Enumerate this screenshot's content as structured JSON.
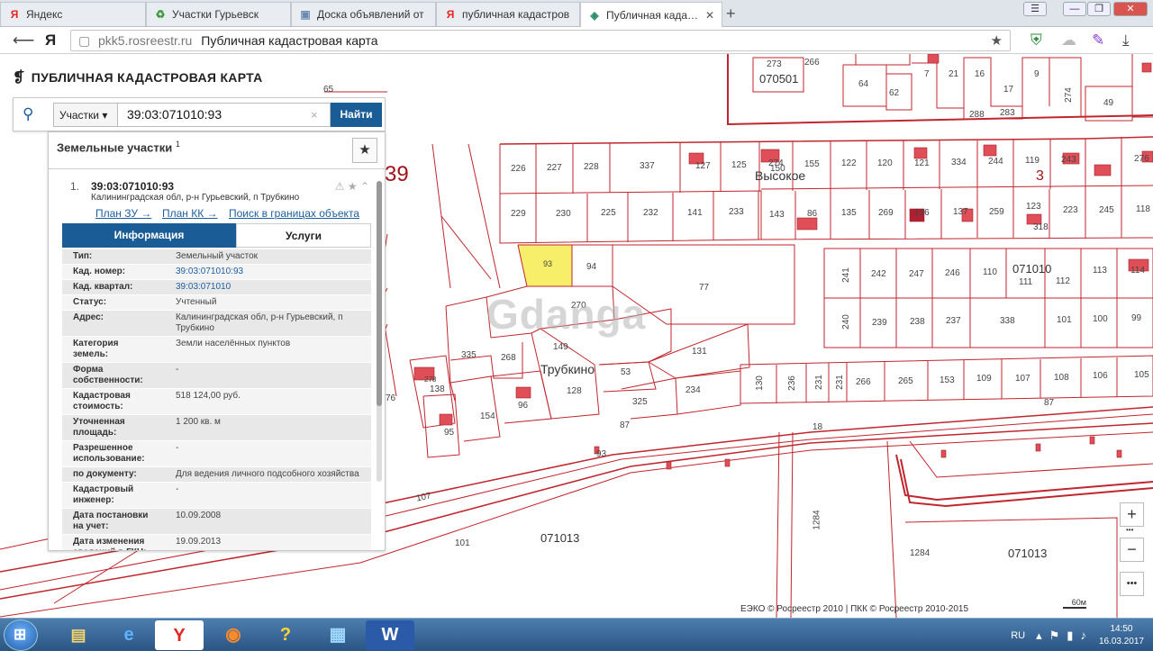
{
  "browser": {
    "tabs": [
      {
        "icon": "Я",
        "title": "Яндекс",
        "color": "#e52620"
      },
      {
        "icon": "♻",
        "title": "Участки Гурьевск",
        "color": "#3a9a3a"
      },
      {
        "icon": "▣",
        "title": "Доска объявлений от",
        "color": "#6a8ab0"
      },
      {
        "icon": "Я",
        "title": "публичная кадастров",
        "color": "#e52620"
      },
      {
        "icon": "◈",
        "title": "Публичная кадастрове",
        "color": "#2a8a6a"
      }
    ],
    "new_tab": "+",
    "window_controls": [
      "☰",
      "—",
      "❐",
      "✕"
    ],
    "url_host": "pkk5.rosreestr.ru",
    "url_title": "Публичная кадастровая карта"
  },
  "app": {
    "title": "ПУБЛИЧНАЯ КАДАСТРОВАЯ КАРТА",
    "search": {
      "type": "Участки",
      "value": "39:03:071010:93",
      "clear": "×",
      "button": "Найти"
    },
    "panel": {
      "title": "Земельные участки",
      "count": "1",
      "result": {
        "num": "1.",
        "cad_number": "39:03:071010:93",
        "address": "Калининградская обл, р-н Гурьевский, п Трубкино",
        "links": [
          "План ЗУ →",
          "План КК →",
          "Поиск в границах объекта →"
        ]
      },
      "tabs": [
        "Информация",
        "Услуги"
      ],
      "attributes": [
        {
          "key": "Тип:",
          "value": "Земельный участок"
        },
        {
          "key": "Кад. номер:",
          "value": "39:03:071010:93",
          "link": true
        },
        {
          "key": "Кад. квартал:",
          "value": "39:03:071010",
          "link": true
        },
        {
          "key": "Статус:",
          "value": "Учтенный"
        },
        {
          "key": "Адрес:",
          "value": "Калининградская обл, р-н Гурьевский, п Трубкино"
        },
        {
          "key": "Категория земель:",
          "value": "Земли населённых пунктов"
        },
        {
          "key": "Форма собственности:",
          "value": "-"
        },
        {
          "key": "Кадастровая стоимость:",
          "value": "518 124,00 руб."
        },
        {
          "key": "Уточненная площадь:",
          "value": "1 200 кв. м"
        },
        {
          "key": "Разрешенное использование:",
          "value": "-"
        },
        {
          "key": "по документу:",
          "value": "Для ведения личного подсобного хозяйства"
        },
        {
          "key": "Кадастровый инженер:",
          "value": "-"
        },
        {
          "key": "Дата постановки на учет:",
          "value": "10.09.2008"
        },
        {
          "key": "Дата изменения сведений в ГКН:",
          "value": "19.09.2013"
        }
      ]
    }
  },
  "map": {
    "labels": [
      "273",
      "266",
      "070501",
      "7",
      "21",
      "16",
      "9",
      "64",
      "62",
      "17",
      "274",
      "49",
      "288",
      "283",
      "226",
      "227",
      "228",
      "337",
      "127",
      "125",
      "274",
      "150",
      "155",
      "122",
      "120",
      "121",
      "334",
      "244",
      "119",
      "243",
      "276",
      "229",
      "230",
      "225",
      "232",
      "141",
      "233",
      "143",
      "86",
      "135",
      "269",
      "136",
      "137",
      "259",
      "123",
      "318",
      "223",
      "245",
      "118",
      "93",
      "94",
      "77",
      "241",
      "242",
      "247",
      "246",
      "110",
      "071010",
      "111",
      "112",
      "113",
      "114",
      "270",
      "240",
      "239",
      "238",
      "237",
      "338",
      "101",
      "100",
      "99",
      "335",
      "268",
      "149",
      "131",
      "53",
      "278",
      "138",
      "128",
      "130",
      "236",
      "231",
      "231",
      "266",
      "265",
      "153",
      "109",
      "107",
      "108",
      "106",
      "105",
      "96",
      "154",
      "325",
      "234",
      "95",
      "87",
      "87",
      "18",
      "93",
      "107",
      "101",
      "071013",
      "1284",
      "1284",
      "071013",
      "65",
      "76"
    ],
    "district_number": "39",
    "district_number_right": "3",
    "places": [
      "Высокое",
      "Трубкино"
    ],
    "watermark": "Gdanga",
    "zoom": [
      "+",
      "•••",
      "−",
      "•••"
    ],
    "copyright": "ЕЭКО © Росреестр 2010 | ПКК © Росреестр 2010-2015",
    "scale": "60м"
  },
  "taskbar": {
    "apps": [
      "e",
      "Y",
      "◉",
      "?",
      "▦",
      "W"
    ],
    "lang": "RU",
    "time": "14:50",
    "date": "16.03.2017"
  },
  "colors": {
    "parcel_line": "#c0262d",
    "selected_parcel": "#f7ef6a",
    "building": "#e04e57",
    "accent": "#1a5c96"
  }
}
